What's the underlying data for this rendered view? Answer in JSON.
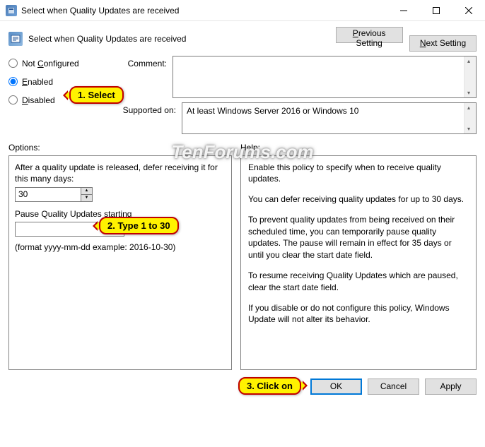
{
  "titlebar": {
    "text": "Select when Quality Updates are received"
  },
  "header": {
    "text": "Select when Quality Updates are received",
    "prev_html": "<span style='text-decoration:underline'>P</span>revious Setting",
    "next_html": "<span style='text-decoration:underline'>N</span>ext Setting"
  },
  "radios": {
    "not_configured": "Not Configured",
    "enabled": "Enabled",
    "disabled": "Disabled",
    "nc_pre": "Not ",
    "nc_u": "C",
    "nc_post": "onfigured",
    "en_u": "E",
    "en_post": "nabled",
    "di_u": "D",
    "di_post": "isabled"
  },
  "comment_label": "Comment:",
  "supported_label": "Supported on:",
  "supported_text": "At least Windows Server 2016 or Windows 10",
  "options_label": "Options:",
  "help_label": "Help:",
  "options": {
    "defer_label": "After a quality update is released, defer receiving it for this many days:",
    "defer_value": "30",
    "pause_label": "Pause Quality Updates starting",
    "pause_value": "",
    "format_hint": "(format yyyy-mm-dd example: 2016-10-30)"
  },
  "help": {
    "p1": "Enable this policy to specify when to receive quality updates.",
    "p2": "You can defer receiving quality updates for up to 30 days.",
    "p3": "To prevent quality updates from being received on their scheduled time, you can temporarily pause quality updates. The pause will remain in effect for 35 days or until you clear the start date field.",
    "p4": "To resume receiving Quality Updates which are paused, clear the start date field.",
    "p5": "If you disable or do not configure this policy, Windows Update will not alter its behavior."
  },
  "footer": {
    "ok": "OK",
    "cancel": "Cancel",
    "apply": "Apply"
  },
  "callouts": {
    "c1": "1. Select",
    "c2": "2. Type 1 to 30",
    "c3": "3. Click on"
  },
  "watermark": "TenForums.com"
}
